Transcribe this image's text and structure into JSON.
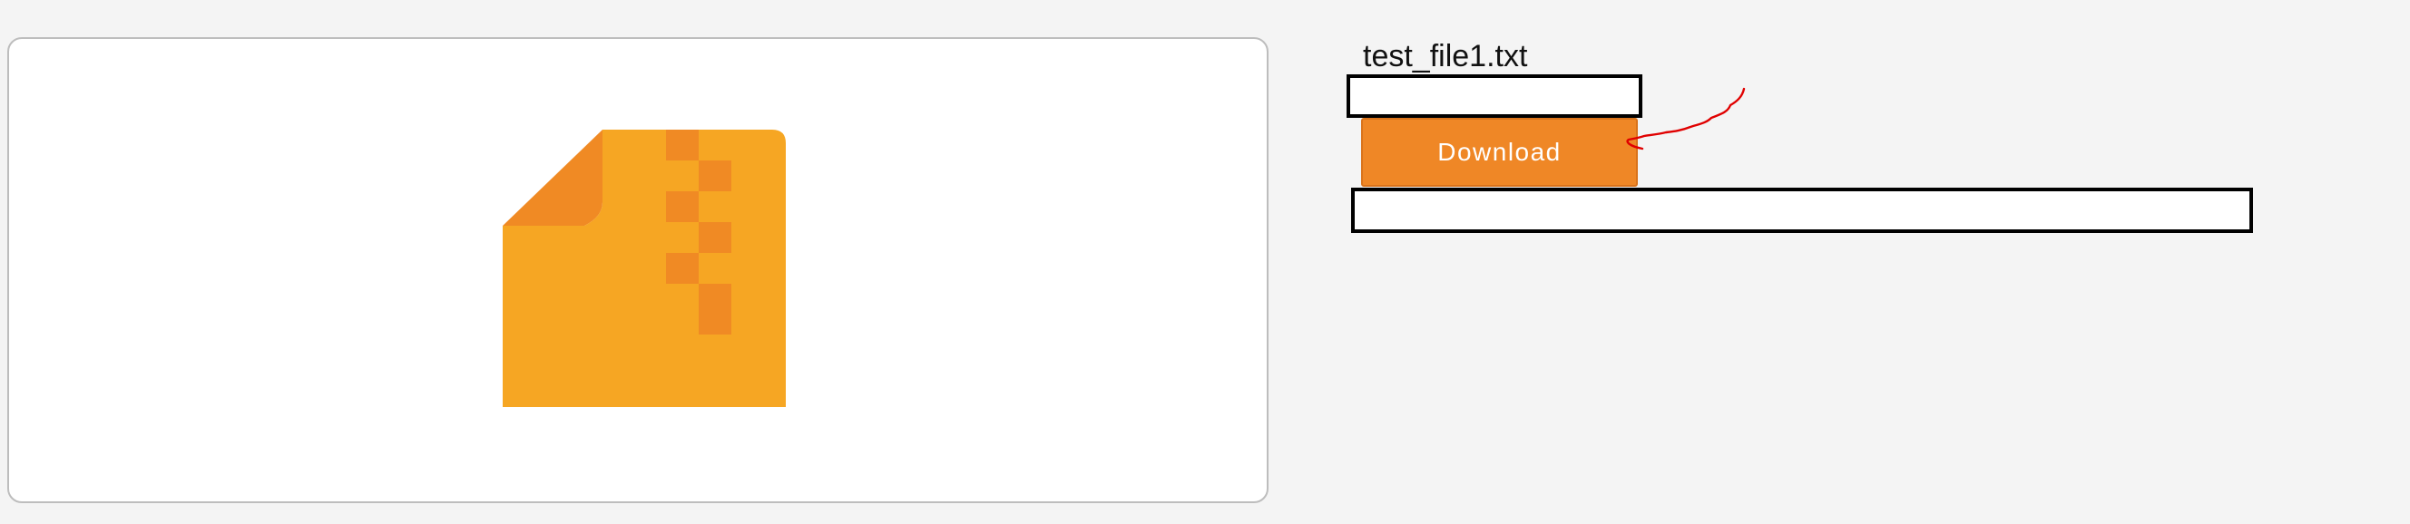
{
  "file": {
    "name": "test_file1.txt",
    "icon": "zip-file-icon"
  },
  "actions": {
    "download_label": "Download"
  },
  "annotation": {
    "icon": "red-hand-drawn-arrow",
    "color": "#e00000"
  },
  "colors": {
    "page_background": "#f4f4f4",
    "preview_background": "#ffffff",
    "preview_border": "#bdbdbd",
    "icon_body": "#f6a623",
    "icon_accent": "#f08a24",
    "button_background": "#ef8726",
    "button_text": "#ffffff",
    "redaction_border": "#000000"
  }
}
